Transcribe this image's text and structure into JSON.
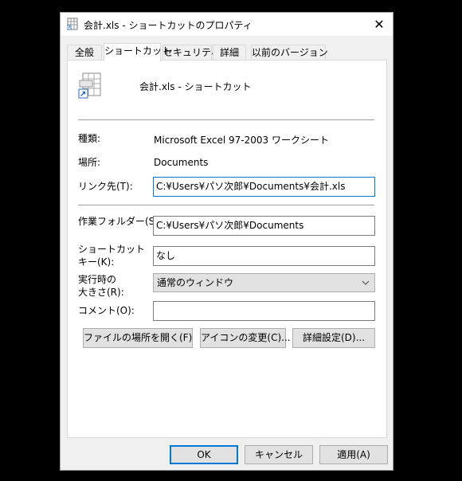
{
  "window": {
    "title": "会計.xls - ショートカットのプロパティ",
    "close_glyph": "✕"
  },
  "tabs": [
    {
      "label": "全般"
    },
    {
      "label": "ショートカット"
    },
    {
      "label": "セキュリティ"
    },
    {
      "label": "詳細"
    },
    {
      "label": "以前のバージョン"
    }
  ],
  "active_tab": "ショートカット",
  "shortcut": {
    "file_name": "会計.xls - ショートカット",
    "type_label": "種類:",
    "type_value": "Microsoft Excel 97-2003 ワークシート",
    "location_label": "場所:",
    "location_value": "Documents",
    "target_label": "リンク先(T):",
    "target_value": "C:¥Users¥パソ次郎¥Documents¥会計.xls",
    "start_in_label": "作業フォルダー(S):",
    "start_in_value": "C:¥Users¥パソ次郎¥Documents",
    "shortcut_key_label": "ショートカット\nキー(K):",
    "shortcut_key_value": "なし",
    "run_label": "実行時の\n大きさ(R):",
    "run_value": "通常のウィンドウ",
    "comment_label": "コメント(O):",
    "comment_value": ""
  },
  "buttons": {
    "open_location": "ファイルの場所を開く(F)",
    "change_icon": "アイコンの変更(C)...",
    "advanced": "詳細設定(D)...",
    "ok": "OK",
    "cancel": "キャンセル",
    "apply": "適用(A)"
  },
  "icons": {
    "title": "excel-shortcut-icon",
    "file": "excel-shortcut-icon",
    "dropdown": "chevron-down-icon"
  },
  "colors": {
    "focus_border": "#0078d7",
    "dialog_bg": "#f0f0f0",
    "panel_bg": "#ffffff"
  }
}
